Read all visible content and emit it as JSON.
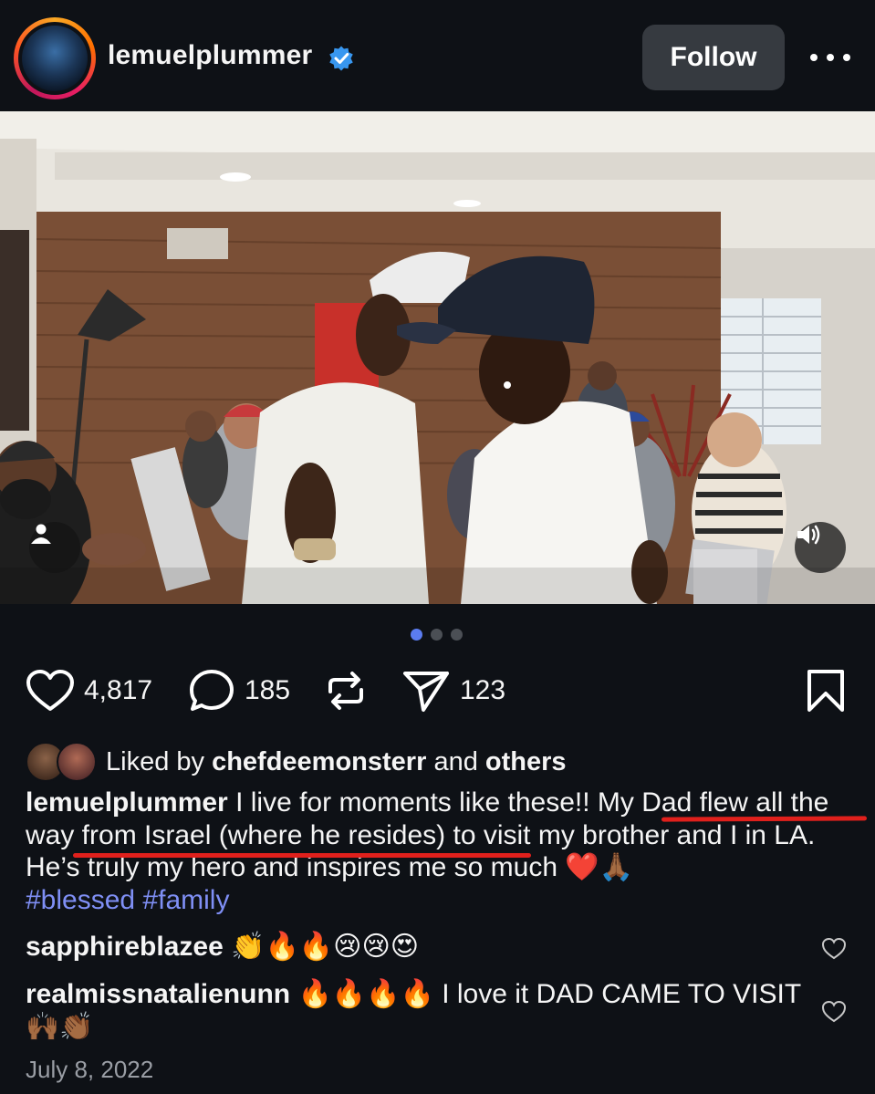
{
  "header": {
    "username": "lemuelplummer",
    "follow_label": "Follow"
  },
  "carousel": {
    "count": 3,
    "active_index": 0
  },
  "actions": {
    "likes": "4,817",
    "comments": "185",
    "shares": "123"
  },
  "liked_by": {
    "prefix": "Liked by",
    "user": "chefdeemonsterr",
    "connector": "and",
    "others": "others"
  },
  "caption": {
    "user": "lemuelplummer",
    "text": "I live for moments like these!! My Dad flew all the way from Israel (where he resides) to visit my brother and I in LA. He’s truly my hero and inspires me so much ❤️🙏🏾",
    "hashtags": "#blessed #family"
  },
  "comments": [
    {
      "user": "sapphireblazee",
      "text": "👏🔥🔥😢😢😍"
    },
    {
      "user": "realmissnatalienunn",
      "text": "🔥🔥🔥🔥 I love it DAD CAME TO VISIT 🙌🏾👏🏾"
    }
  ],
  "date": "July 8, 2022",
  "colors": {
    "background": "#0e1116",
    "hashtag": "#7f8ff5",
    "follow_bg": "#363a40",
    "annotation_red": "#e0201c",
    "carousel_active": "#5b7cf0"
  },
  "icons": [
    "avatar",
    "verified-badge-icon",
    "more-options-icon",
    "user-tag-icon",
    "volume-icon",
    "heart-icon",
    "comment-icon",
    "repost-icon",
    "share-icon",
    "bookmark-icon"
  ]
}
